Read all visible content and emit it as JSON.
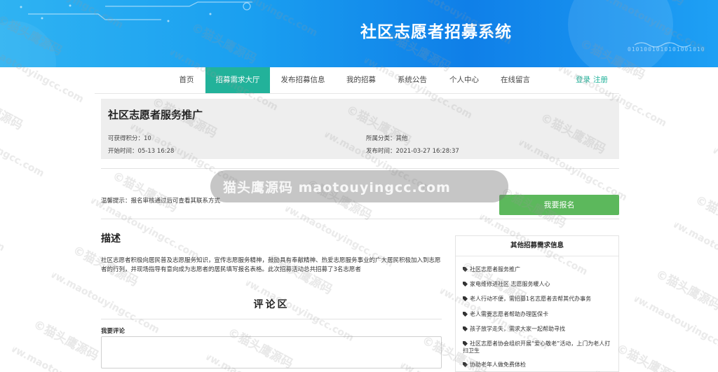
{
  "header": {
    "title": "社区志愿者招募系统",
    "code_text": "0101001010101001010"
  },
  "nav": {
    "items": [
      "首页",
      "招募需求大厅",
      "发布招募信息",
      "我的招募",
      "系统公告",
      "个人中心",
      "在线留言"
    ],
    "active_index": 1,
    "login": "登录",
    "register": "注册"
  },
  "detail": {
    "title": "社区志愿者服务推广",
    "points_label": "可获得积分：",
    "points_value": "10",
    "category_label": "所属分类：",
    "category_value": "其他",
    "start_label": "开始时间：",
    "start_value": "05-13 16:28",
    "publish_label": "发布时间：",
    "publish_value": "2021-03-27 16:28:37"
  },
  "tip": "温馨提示：报名审核通过后可查看其联系方式",
  "signup_button": "我要报名",
  "description": {
    "heading": "描述",
    "text": "社区志愿者积极向居民普及志愿服务知识，宣传志愿服务精神，鼓励具有奉献精神、热爱志愿服务事业的广大居民积极加入到志愿者的行列，并现场指导有意向成为志愿者的居民填写报名表格。此次招募活动总共招募了3名志愿者"
  },
  "comments": {
    "heading": "评论区",
    "my_comment_label": "我要评论",
    "placeholder": ""
  },
  "sidebar": {
    "title": "其他招募需求信息",
    "items": [
      "社区志愿者服务推广",
      "家电维修进社区 志愿服务暖人心",
      "老人行动不便，需招募1名志愿者去帮其代办事务",
      "老人需要志愿者帮助办理医保卡",
      "孩子放学走失，需求大家一起帮助寻找",
      "社区志愿者协会组织开展“爱心敬老”活动，上门为老人打扫卫生",
      "协助老年人做免费体检"
    ]
  },
  "watermark": {
    "center_text": "猫头鹰源码 maotouyingcc.com",
    "tile_cn": "©猫头鹰源码",
    "tile_en": "www.maotouyingcc.com"
  },
  "colors": {
    "accent": "#22b29a",
    "button": "#5cb85c",
    "banner_start": "#2fb3f2",
    "banner_end": "#0f7fe8"
  }
}
